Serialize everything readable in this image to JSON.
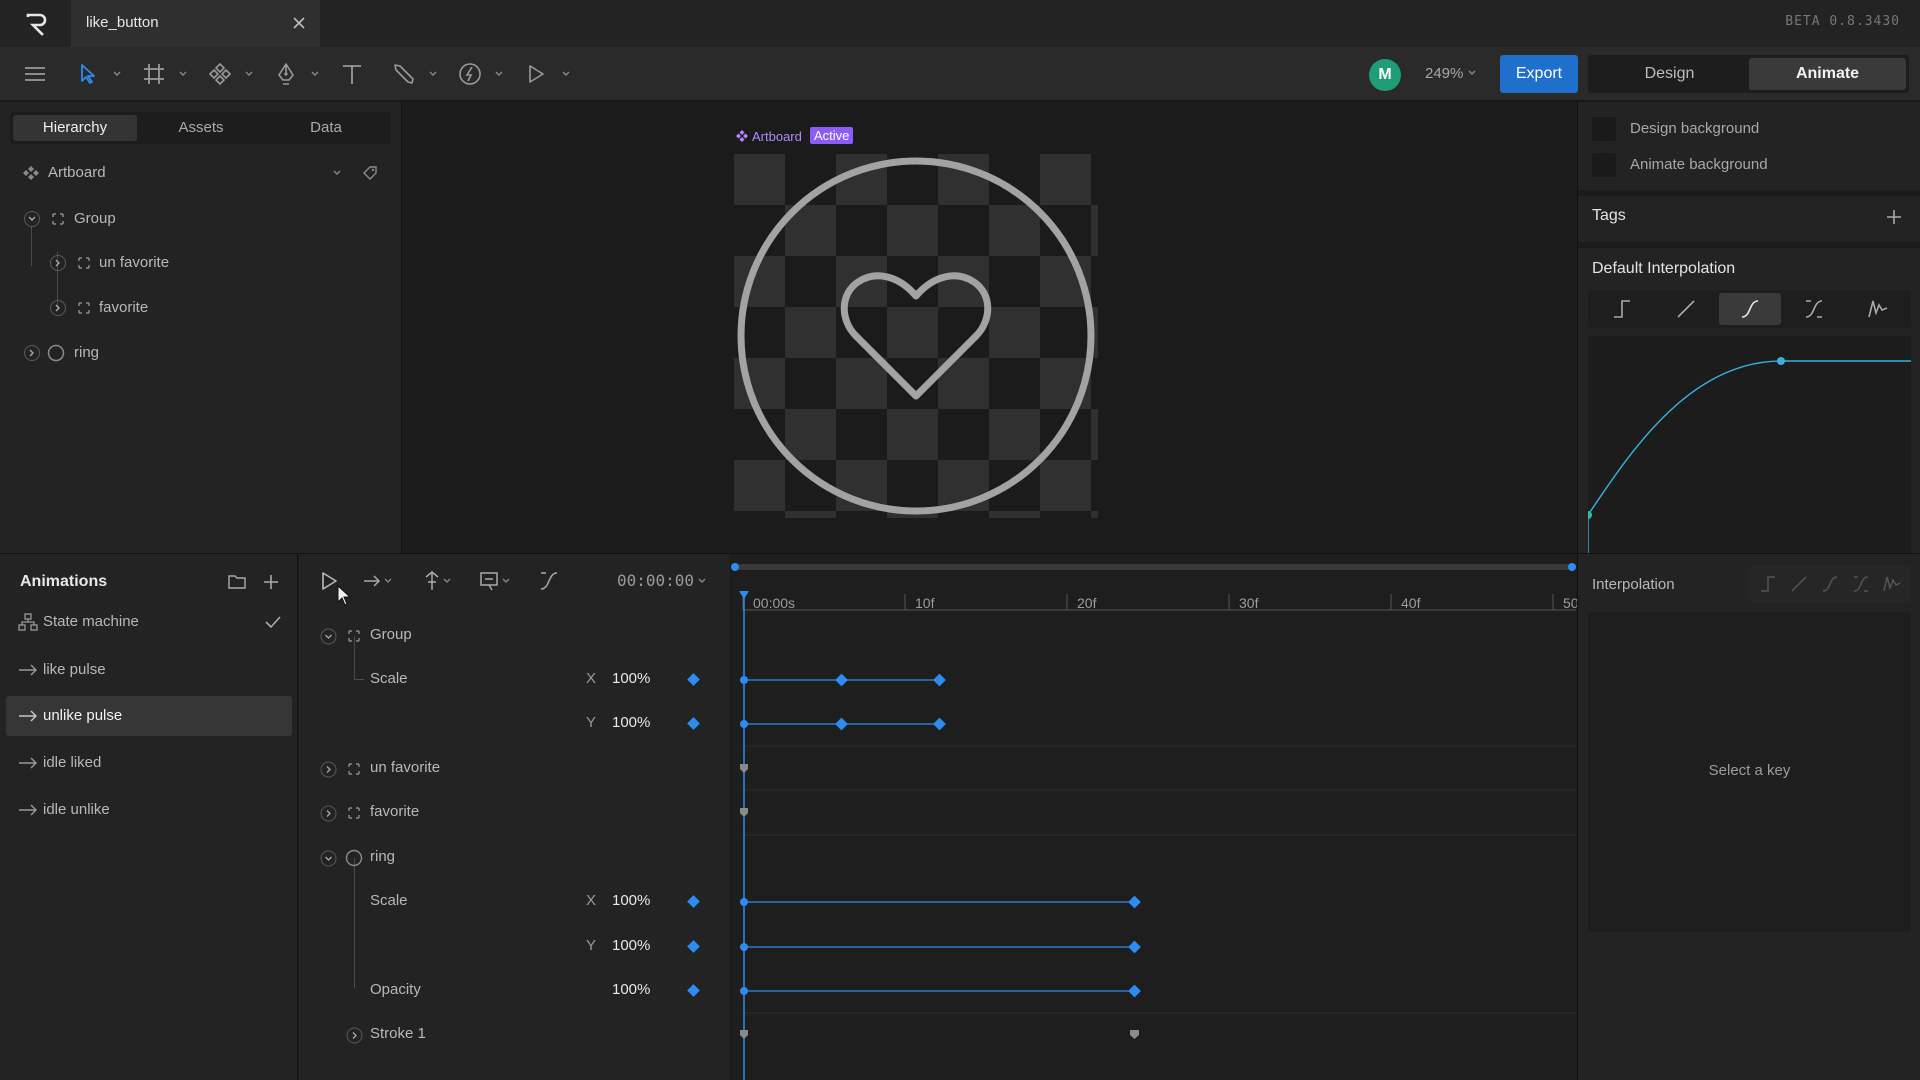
{
  "app": {
    "file_name": "like_button",
    "version": "BETA 0.8.3430"
  },
  "toolbar": {
    "avatar_initial": "M",
    "zoom": "249%",
    "export_label": "Export",
    "modes": [
      "Design",
      "Animate"
    ],
    "active_mode": "Animate"
  },
  "left_panel": {
    "tabs": [
      "Hierarchy",
      "Assets",
      "Data"
    ],
    "active_tab": "Hierarchy",
    "hierarchy": {
      "artboard": "Artboard",
      "group": "Group",
      "un_favorite": "un favorite",
      "favorite": "favorite",
      "ring": "ring"
    }
  },
  "canvas": {
    "artboard_label": "Artboard",
    "active_badge": "Active"
  },
  "right_panel": {
    "design_background": "Design background",
    "animate_background": "Animate background",
    "tags_title": "Tags",
    "default_interpolation_title": "Default Interpolation",
    "interpolation_modes": [
      "hold",
      "linear",
      "cubic",
      "cubic-custom",
      "elastic"
    ],
    "active_interpolation": "cubic"
  },
  "animations": {
    "title": "Animations",
    "items": [
      {
        "label": "State machine",
        "kind": "state-machine"
      },
      {
        "label": "like pulse",
        "kind": "animation"
      },
      {
        "label": "unlike pulse",
        "kind": "animation"
      },
      {
        "label": "idle liked",
        "kind": "animation"
      },
      {
        "label": "idle unlike",
        "kind": "animation"
      }
    ],
    "selected": "unlike pulse"
  },
  "timeline": {
    "time": "00:00:00",
    "ruler": [
      "00:00s",
      "10f",
      "20f",
      "30f",
      "40f",
      "50"
    ],
    "rows": {
      "group": "Group",
      "group_scale": "Scale",
      "group_scale_x_axis": "X",
      "group_scale_x": "100%",
      "group_scale_y_axis": "Y",
      "group_scale_y": "100%",
      "un_favorite": "un favorite",
      "favorite": "favorite",
      "ring": "ring",
      "ring_scale": "Scale",
      "ring_scale_x_axis": "X",
      "ring_scale_x": "100%",
      "ring_scale_y_axis": "Y",
      "ring_scale_y": "100%",
      "ring_opacity": "Opacity",
      "ring_opacity_val": "100%",
      "stroke": "Stroke 1"
    }
  },
  "interpolation_panel": {
    "title": "Interpolation",
    "empty_message": "Select a key"
  },
  "colors": {
    "accent_blue": "#2d8cf0",
    "export_blue": "#1f6fcc",
    "avatar_green": "#1e9d78",
    "artboard_purple": "#8b5cf6",
    "curve_teal": "#39b0e0"
  }
}
